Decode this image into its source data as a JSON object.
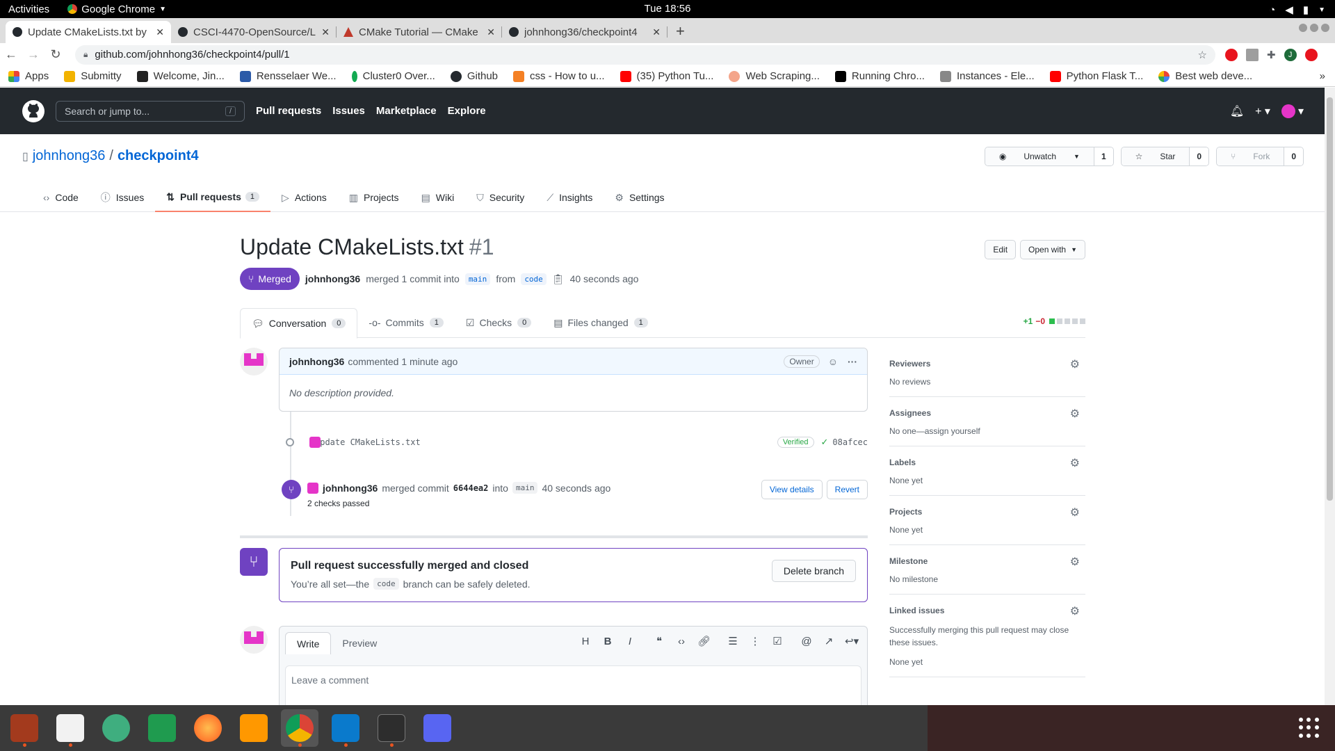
{
  "os": {
    "activities": "Activities",
    "app": "Google Chrome",
    "clock": "Tue 18:56"
  },
  "browser": {
    "tabs": [
      {
        "title": "Update CMakeLists.txt by",
        "active": true
      },
      {
        "title": "CSCI-4470-OpenSource/L",
        "active": false
      },
      {
        "title": "CMake Tutorial — CMake",
        "active": false
      },
      {
        "title": "johnhong36/checkpoint4",
        "active": false
      }
    ],
    "url": "github.com/johnhong36/checkpoint4/pull/1",
    "bookmarks": [
      "Apps",
      "Submitty",
      "Welcome, Jin...",
      "Rensselaer We...",
      "Cluster0 Over...",
      "Github",
      "css - How to u...",
      "(35) Python Tu...",
      "Web Scraping...",
      "Running Chro...",
      "Instances - Ele...",
      "Python Flask T...",
      "Best web deve..."
    ],
    "profile_initial": "J"
  },
  "github": {
    "search_placeholder": "Search or jump to...",
    "search_key": "/",
    "nav": [
      "Pull requests",
      "Issues",
      "Marketplace",
      "Explore"
    ]
  },
  "repo": {
    "owner": "johnhong36",
    "sep": "/",
    "name": "checkpoint4",
    "unwatch": "Unwatch",
    "watch_count": "1",
    "star": "Star",
    "star_count": "0",
    "fork": "Fork",
    "fork_count": "0",
    "tabs": [
      "Code",
      "Issues",
      "Pull requests",
      "Actions",
      "Projects",
      "Wiki",
      "Security",
      "Insights",
      "Settings"
    ],
    "pr_count": "1"
  },
  "pr": {
    "title": "Update CMakeLists.txt",
    "number": "#1",
    "edit": "Edit",
    "open_with": "Open with",
    "state": "Merged",
    "author": "johnhong36",
    "merged_text": "merged 1 commit into",
    "base": "main",
    "from": "from",
    "head": "code",
    "time": "40 seconds ago",
    "tabs": [
      {
        "label": "Conversation",
        "count": "0"
      },
      {
        "label": "Commits",
        "count": "1"
      },
      {
        "label": "Checks",
        "count": "0"
      },
      {
        "label": "Files changed",
        "count": "1"
      }
    ],
    "additions": "+1",
    "deletions": "−0"
  },
  "comment": {
    "author": "johnhong36",
    "text": "commented 1 minute ago",
    "owner": "Owner",
    "body": "No description provided."
  },
  "commit": {
    "message": "Update CMakeLists.txt",
    "verified": "Verified",
    "sha": "08afcec"
  },
  "merge_event": {
    "author": "johnhong36",
    "text1": "merged commit",
    "sha": "6644ea2",
    "text2": "into",
    "branch": "main",
    "time": "40 seconds ago",
    "checks": "2 checks passed",
    "view": "View details",
    "revert": "Revert"
  },
  "merged_box": {
    "title": "Pull request successfully merged and closed",
    "pre": "You’re all set—the",
    "branch": "code",
    "post": "branch can be safely deleted.",
    "delete": "Delete branch"
  },
  "composer": {
    "write": "Write",
    "preview": "Preview",
    "placeholder": "Leave a comment"
  },
  "sidebar": [
    {
      "h": "Reviewers",
      "v": "No reviews"
    },
    {
      "h": "Assignees",
      "v": "No one—assign yourself"
    },
    {
      "h": "Labels",
      "v": "None yet"
    },
    {
      "h": "Projects",
      "v": "None yet"
    },
    {
      "h": "Milestone",
      "v": "No milestone"
    },
    {
      "h": "Linked issues",
      "d": "Successfully merging this pull request may close these issues.",
      "v": "None yet"
    }
  ],
  "colors": {
    "merged": "#6f42c1",
    "link": "#0366d6",
    "header": "#24292e",
    "accent_tab": "#f9826c",
    "avatar": "#e535c8"
  }
}
